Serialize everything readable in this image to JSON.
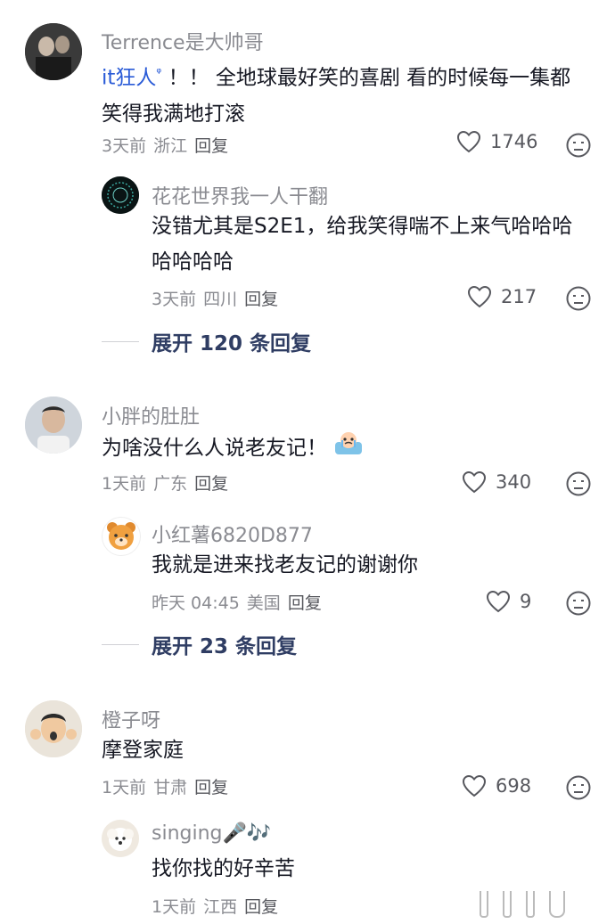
{
  "comments": [
    {
      "user": "Terrence是大帅哥",
      "link_text": "it狂人",
      "text": "！！ 全地球最好笑的喜剧 看的时候每一集都笑得我满地打滚",
      "time": "3天前",
      "location": "浙江",
      "reply_label": "回复",
      "likes": "1746",
      "replies": [
        {
          "user": "花花世界我一人干翻",
          "text": "没错尤其是S2E1，给我笑得喘不上来气哈哈哈哈哈哈哈",
          "time": "3天前",
          "location": "四川",
          "reply_label": "回复",
          "likes": "217"
        }
      ],
      "expand_label": "展开 120 条回复"
    },
    {
      "user": "小胖的肚肚",
      "text": "为啥没什么人说老友记！",
      "time": "1天前",
      "location": "广东",
      "reply_label": "回复",
      "likes": "340",
      "replies": [
        {
          "user": "小红薯6820D877",
          "text": "我就是进来找老友记的谢谢你",
          "time": "昨天 04:45",
          "location": "美国",
          "reply_label": "回复",
          "likes": "9"
        }
      ],
      "expand_label": "展开 23 条回复"
    },
    {
      "user": "橙子呀",
      "text": "摩登家庭",
      "time": "1天前",
      "location": "甘肃",
      "reply_label": "回复",
      "likes": "698",
      "replies": [
        {
          "user": "singing🎤🎶",
          "text": "找你找的好辛苦",
          "time": "1天前",
          "location": "江西",
          "reply_label": "回复"
        }
      ]
    }
  ],
  "colors": {
    "link": "#2a5bd7",
    "muted": "#8a8b91",
    "expand": "#2f3d63"
  }
}
